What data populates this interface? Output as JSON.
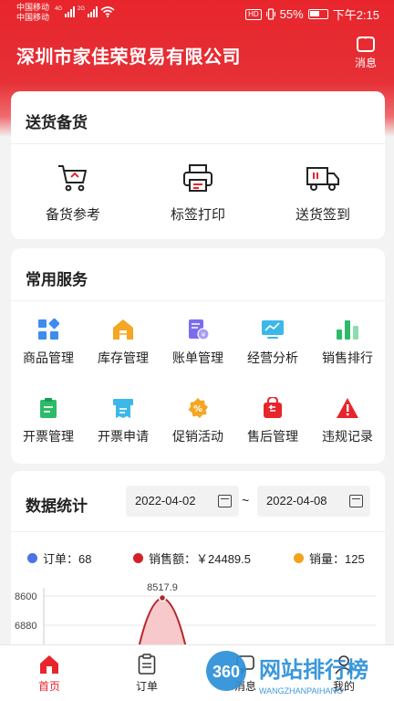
{
  "status": {
    "carrier1": "中国移动",
    "carrier2": "中国移动",
    "net1": "4G",
    "net2": "2G",
    "hd": "HD",
    "battery": "55%",
    "time": "下午2:15"
  },
  "header": {
    "title": "深圳市家佳荣贸易有限公司",
    "message_label": "消息"
  },
  "delivery": {
    "title": "送货备货",
    "items": [
      {
        "label": "备货参考",
        "icon": "shopping-cart-icon"
      },
      {
        "label": "标签打印",
        "icon": "printer-icon"
      },
      {
        "label": "送货签到",
        "icon": "delivery-truck-icon"
      }
    ]
  },
  "services": {
    "title": "常用服务",
    "items": [
      {
        "label": "商品管理",
        "icon": "grid-shapes-icon",
        "color": "#3d8cf0"
      },
      {
        "label": "库存管理",
        "icon": "warehouse-icon",
        "color": "#f5a623"
      },
      {
        "label": "账单管理",
        "icon": "bill-icon",
        "color": "#7b6cf0"
      },
      {
        "label": "经营分析",
        "icon": "monitor-chart-icon",
        "color": "#3bb8e8"
      },
      {
        "label": "销售排行",
        "icon": "bar-rank-icon",
        "color": "#2dbb6a"
      },
      {
        "label": "开票管理",
        "icon": "clipboard-icon",
        "color": "#2dbb6a"
      },
      {
        "label": "开票申请",
        "icon": "receipt-icon",
        "color": "#3bb8e8"
      },
      {
        "label": "促销活动",
        "icon": "discount-icon",
        "color": "#f5a623"
      },
      {
        "label": "售后管理",
        "icon": "return-bag-icon",
        "color": "#e8252c"
      },
      {
        "label": "违规记录",
        "icon": "warning-icon",
        "color": "#e8252c"
      }
    ]
  },
  "stats": {
    "title": "数据统计",
    "date_from": "2022-04-02",
    "date_to": "2022-04-08",
    "separator": "~",
    "legend": [
      {
        "label": "订单：",
        "value": "68",
        "color": "#4a73e8"
      },
      {
        "label": "销售额：",
        "value": "￥24489.5",
        "color": "#d62027"
      },
      {
        "label": "销量：",
        "value": "125",
        "color": "#f2a31b"
      }
    ]
  },
  "chart_data": {
    "type": "area",
    "y_ticks": [
      "8600",
      "6880"
    ],
    "peak_label": "8517.9",
    "peak_value": 8517.9,
    "series_color": "#b5262a"
  },
  "tabbar": {
    "tabs": [
      {
        "label": "首页",
        "active": true
      },
      {
        "label": "订单",
        "active": false
      },
      {
        "label": "消息",
        "active": false
      },
      {
        "label": "我的",
        "active": false
      }
    ]
  },
  "watermark": {
    "number": "360",
    "text": "网站排行榜",
    "url": "WANGZHANPAIHANG"
  }
}
